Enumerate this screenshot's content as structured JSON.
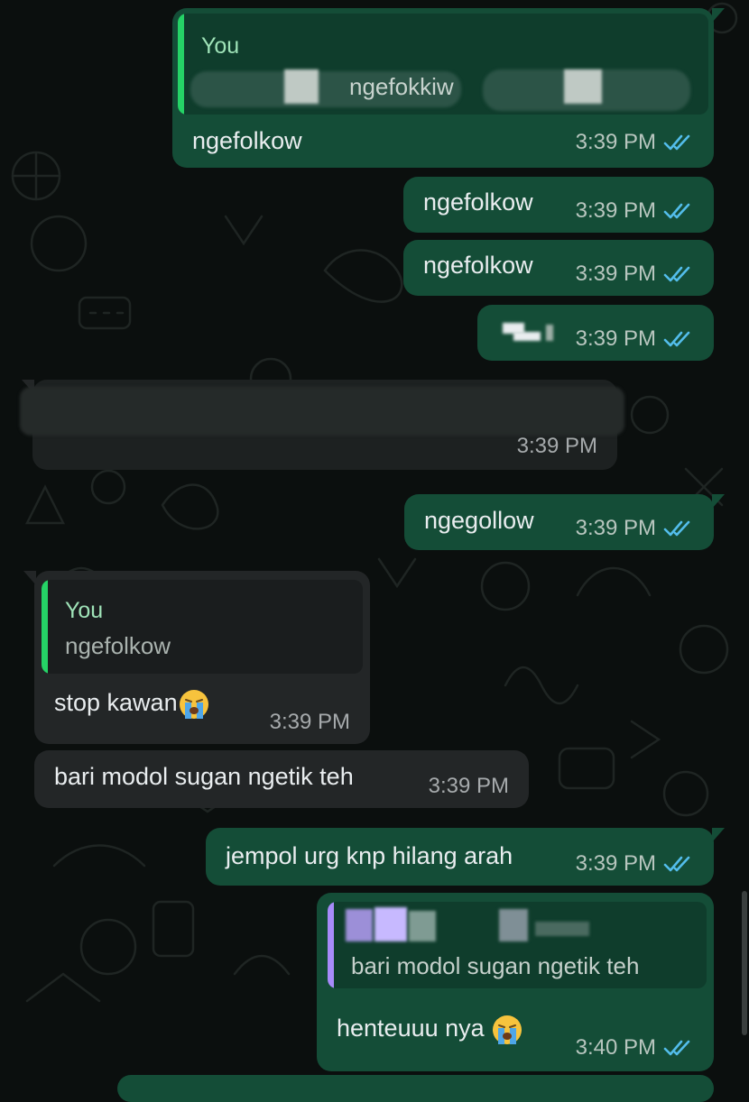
{
  "colors": {
    "outgoing_bubble": "#144d37",
    "incoming_bubble": "#232627",
    "background": "#0b0f0e",
    "read_ticks": "#53bdeb",
    "quote_you_name": "#25d366",
    "quote_purple_bar": "#a78bfa"
  },
  "messages": [
    {
      "direction": "out",
      "quote": {
        "author": "You",
        "text": "ngefokkiw"
      },
      "text": "ngefolkow",
      "time": "3:39 PM",
      "status_icon": "double-check-read-icon"
    },
    {
      "direction": "out",
      "text": "ngefolkow",
      "time": "3:39 PM",
      "status_icon": "double-check-read-icon"
    },
    {
      "direction": "out",
      "text": "ngefolkow",
      "time": "3:39 PM",
      "status_icon": "double-check-read-icon"
    },
    {
      "direction": "out",
      "text": "",
      "time": "3:39 PM",
      "status_icon": "double-check-read-icon"
    },
    {
      "direction": "in",
      "text": "",
      "time": "3:39 PM"
    },
    {
      "direction": "out",
      "text": "ngegollow",
      "time": "3:39 PM",
      "status_icon": "double-check-read-icon"
    },
    {
      "direction": "in",
      "quote": {
        "author": "You",
        "text": "ngefolkow"
      },
      "text": "stop kawan",
      "emoji": "loudly-crying-face-icon",
      "time": "3:39 PM"
    },
    {
      "direction": "in",
      "text": "bari modol sugan ngetik teh",
      "time": "3:39 PM"
    },
    {
      "direction": "out",
      "text": "jempol urg knp hilang arah",
      "time": "3:39 PM",
      "status_icon": "double-check-read-icon"
    },
    {
      "direction": "out",
      "quote": {
        "author": "",
        "text": "bari modol sugan ngetik teh"
      },
      "text": "henteuuu nya",
      "emoji": "loudly-crying-face-icon",
      "time": "3:40 PM",
      "status_icon": "double-check-read-icon"
    }
  ]
}
